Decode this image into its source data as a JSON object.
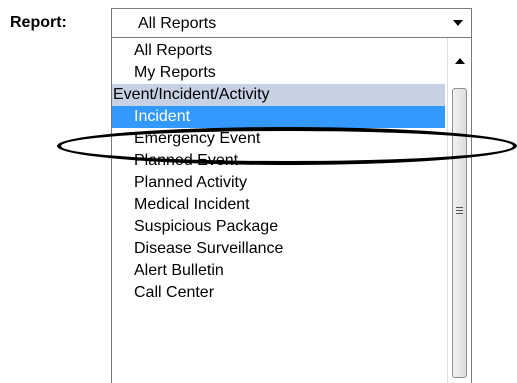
{
  "report_label": "Report:",
  "select": {
    "value": "All Reports"
  },
  "options": [
    {
      "label": "All Reports"
    },
    {
      "label": "My Reports"
    },
    {
      "label": "Event/Incident/Activity"
    },
    {
      "label": "Incident"
    },
    {
      "label": "Emergency Event"
    },
    {
      "label": "Planned Event"
    },
    {
      "label": "Planned Activity"
    },
    {
      "label": "Medical Incident"
    },
    {
      "label": "Suspicious Package"
    },
    {
      "label": "Disease Surveillance"
    },
    {
      "label": "Alert Bulletin"
    },
    {
      "label": "Call Center"
    }
  ],
  "icons": {
    "dropdown_arrow": "chevron-down-icon",
    "scroll_up": "scroll-up-arrow-icon",
    "scroll_thumb_grip": "grip-icon"
  },
  "colors": {
    "selected_background": "#3399ff",
    "selected_text": "#ffffff",
    "group_background": "#c6d1e4",
    "annotation": "#000000"
  }
}
